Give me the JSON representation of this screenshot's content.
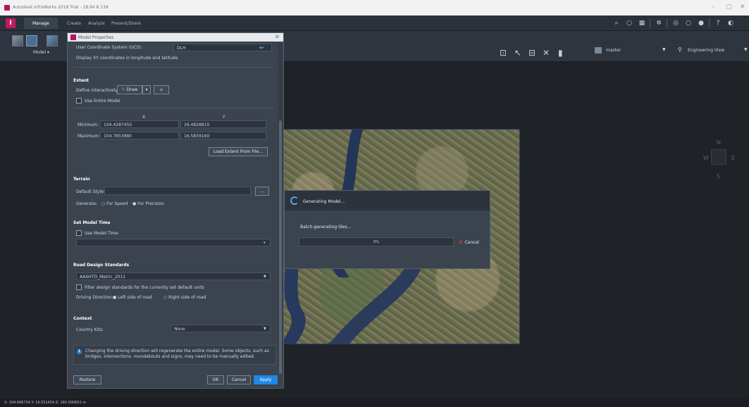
{
  "window": {
    "title": "Autodesk InfraWorks 2018 Trial - 18.94 8.138",
    "controls": [
      "–",
      "▢",
      "✕"
    ]
  },
  "ribbon": {
    "tabs": [
      {
        "label": "Manage"
      },
      {
        "label": "Create"
      },
      {
        "label": "Analyze"
      },
      {
        "label": "Present/Share"
      }
    ],
    "model_label": "Model ▾",
    "view_dropdown": "Engineering View",
    "master_dropdown": "master"
  },
  "dialog": {
    "title": "Model Properties",
    "ucs_label": "User Coordinate System (UCS):",
    "ucs_value": "DLH",
    "display_xy": "Display XY coordinates in longitude and latitude",
    "extent": {
      "header": "Extent",
      "define_label": "Define interactively:",
      "define_button": "Draw",
      "use_entire": "Use Entire Model",
      "col_x": "X",
      "col_y": "Y",
      "min_label": "Minimum:",
      "min_x": "104.4287450",
      "min_y": "16.4828810",
      "max_label": "Maximum:",
      "max_x": "104.7853880",
      "max_y": "16.5839160",
      "load_button": "Load Extent From File..."
    },
    "terrain": {
      "header": "Terrain",
      "default_style": "Default Style:",
      "browse": "...",
      "generate": "Generate:",
      "for_speed": "For Speed",
      "for_precision": "For Precision"
    },
    "model_time": {
      "header": "Set Model Time",
      "use_model_time": "Use Model Time"
    },
    "road_design": {
      "header": "Road Design Standards",
      "standard": "AASHTO_Metric_2011",
      "filter": "Filter design standards for the currently set default units",
      "driving_direction": "Driving Direction:",
      "left": "Left side of road",
      "right": "Right side of road"
    },
    "context": {
      "header": "Context",
      "country_label": "Country Kits:",
      "country_value": "None"
    },
    "info": "Changing the driving direction will regenerate the entire model. Some objects, such as bridges, intersections, roundabouts and signs, may need to be manually edited.",
    "buttons": {
      "restore": "Restore",
      "ok": "OK",
      "cancel": "Cancel",
      "apply": "Apply"
    }
  },
  "progress": {
    "title": "Generating Model...",
    "subtitle": "Batch-generating tiles...",
    "percent": 0,
    "percent_label": "0%",
    "cancel": "Cancel"
  },
  "compass": {
    "n": "N",
    "s": "S",
    "e": "E",
    "w": "W"
  },
  "status": {
    "coords": "X: 104.696734 Y: 16.551454 Z: 160.000651 m"
  },
  "colors": {
    "accent": "#1e88e5",
    "brand": "#c01a62",
    "cancel_x": "#e53935"
  }
}
